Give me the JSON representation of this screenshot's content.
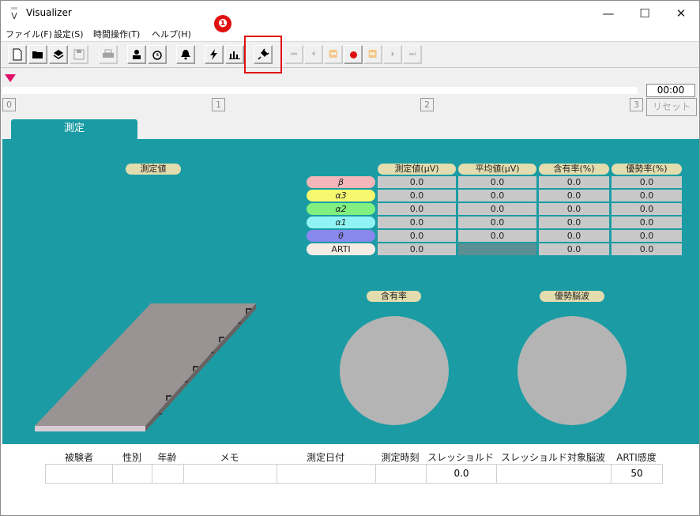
{
  "window": {
    "title": "Visualizer",
    "minimize": "—",
    "maximize": "☐",
    "close": "✕"
  },
  "menu": [
    "ファイル(F)",
    "設定(S)",
    "時間操作(T)",
    "ヘルプ(H)"
  ],
  "annotation": {
    "badge": "❶"
  },
  "timeline": {
    "time": "00:00",
    "ticks": [
      "0",
      "1",
      "2",
      "3"
    ],
    "reset_label": "リセット"
  },
  "tab": {
    "label": "測定"
  },
  "panel": {
    "measured_label": "測定値",
    "content_rate_label": "含有率",
    "dominant_wave_label": "優勢脳波"
  },
  "grid": {
    "headers": [
      "測定値(μV)",
      "平均値(μV)",
      "含有率(%)",
      "優勢率(%)"
    ],
    "rows": [
      {
        "label": "β",
        "color": "#f4b6b8",
        "values": [
          "0.0",
          "0.0",
          "0.0",
          "0.0"
        ]
      },
      {
        "label": "α3",
        "color": "#f8f870",
        "values": [
          "0.0",
          "0.0",
          "0.0",
          "0.0"
        ]
      },
      {
        "label": "α2",
        "color": "#80f080",
        "values": [
          "0.0",
          "0.0",
          "0.0",
          "0.0"
        ]
      },
      {
        "label": "α1",
        "color": "#90f4f4",
        "values": [
          "0.0",
          "0.0",
          "0.0",
          "0.0"
        ]
      },
      {
        "label": "θ",
        "color": "#8888ee",
        "values": [
          "0.0",
          "0.0",
          "0.0",
          "0.0"
        ]
      },
      {
        "label": "ARTI",
        "color": "#f4ece4",
        "values": [
          "0.0",
          "",
          "0.0",
          "0.0"
        ]
      }
    ]
  },
  "info": {
    "headers": [
      "被験者",
      "性別",
      "年齢",
      "メモ",
      "測定日付",
      "測定時刻",
      "スレッショルド",
      "スレッショルド対象脳波",
      "ARTI感度"
    ],
    "values": [
      "",
      "",
      "",
      "",
      "",
      "",
      "0.0",
      "",
      "50"
    ]
  },
  "colors": {
    "panel": "#1b9ca4",
    "highlight": "#e01010",
    "marker": "#e0106a"
  }
}
